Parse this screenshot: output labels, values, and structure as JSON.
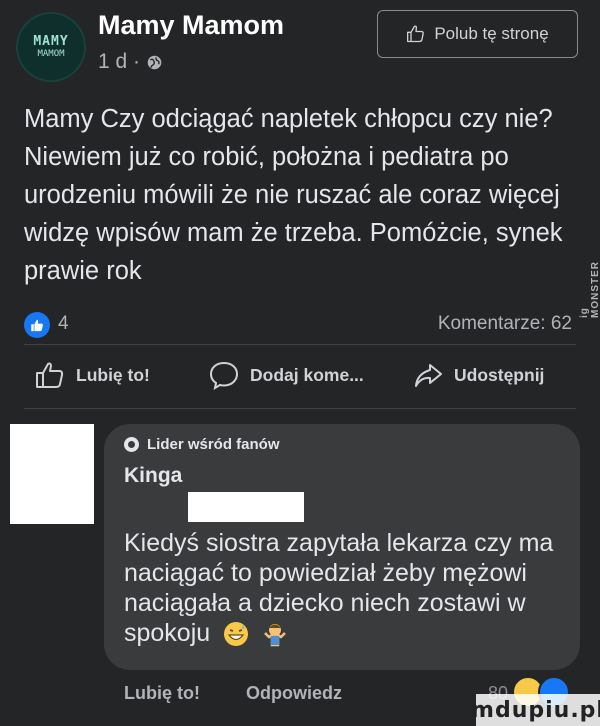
{
  "header": {
    "avatar_line1": "MAMY",
    "avatar_line2": "MAMOM",
    "page_name": "Mamy Mamom",
    "post_meta": "1 d ·",
    "follow_button": "Polub tę stronę"
  },
  "post": {
    "text": "Mamy Czy odciągać napletek chłopcu czy nie? Niewiem już co robić, położna i pediatra po urodzeniu mówili że nie ruszać ale coraz więcej widzę wpisów mam że trzeba. Pomóżcie, synek prawie rok"
  },
  "reactions": {
    "like_count": "4",
    "comments_label": "Komentarze: 62",
    "side_watermark": "ig MONSTER"
  },
  "actions": {
    "like": "Lubię to!",
    "comment": "Dodaj kome...",
    "share": "Udostępnij"
  },
  "comment": {
    "badge": "Lider wśród fanów",
    "author": "Kinga",
    "text": "Kiedyś siostra zapytała lekarza czy ma naciągać to powiedział żeby mężowi naciągała a dziecko niech zostawi w spokoju",
    "like_action": "Lubię to!",
    "reply_action": "Odpowiedz",
    "reaction_count": "80"
  },
  "watermark": "mdupiu.pl",
  "colors": {
    "background": "#242526",
    "bubble": "#3a3b3c",
    "like_blue": "#1877f2"
  }
}
